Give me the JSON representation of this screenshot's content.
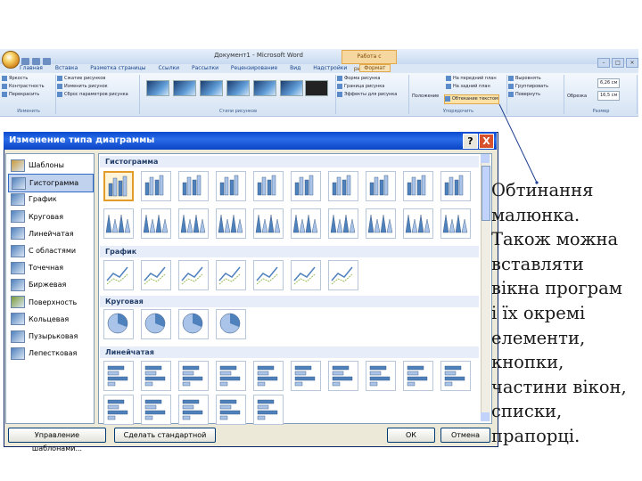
{
  "word_window": {
    "title": "Документ1 - Microsoft Word",
    "context_tab_title": "Работа с рисунками",
    "tabs": [
      "Главная",
      "Вставка",
      "Разметка страницы",
      "Ссылки",
      "Рассылки",
      "Рецензирование",
      "Вид",
      "Надстройки",
      "Формат"
    ],
    "active_tab": "Формат",
    "groups": [
      {
        "label": "Изменить",
        "rows": [
          "Яркость",
          "Контрастность",
          "Перекрасить"
        ]
      },
      {
        "label": "",
        "rows": [
          "Сжатие рисунков",
          "Изменить рисунок",
          "Сброс параметров рисунка"
        ]
      },
      {
        "label": "Стили рисунков",
        "rows": []
      },
      {
        "label": "",
        "rows": [
          "Форма рисунка",
          "Граница рисунка",
          "Эффекты для рисунка"
        ]
      },
      {
        "label": "Упорядочить",
        "rows": [
          "Положение",
          "На передний план",
          "На задний план",
          "Обтекание текстом"
        ]
      },
      {
        "label": "",
        "rows": [
          "Выровнять",
          "Группировать",
          "Повернуть"
        ]
      },
      {
        "label": "Размер",
        "rows": [
          "Обрезка",
          "6,26 см",
          "16,5 см"
        ]
      }
    ]
  },
  "dialog": {
    "title": "Изменение типа диаграммы",
    "help": "?",
    "close": "X",
    "chart_types": [
      {
        "label": "Шаблоны",
        "icon": "folder-icon"
      },
      {
        "label": "Гистограмма",
        "icon": "column-chart-icon",
        "selected": true
      },
      {
        "label": "График",
        "icon": "line-chart-icon"
      },
      {
        "label": "Круговая",
        "icon": "pie-chart-icon"
      },
      {
        "label": "Линейчатая",
        "icon": "bar-chart-icon"
      },
      {
        "label": "С областями",
        "icon": "area-chart-icon"
      },
      {
        "label": "Точечная",
        "icon": "scatter-chart-icon"
      },
      {
        "label": "Биржевая",
        "icon": "stock-chart-icon"
      },
      {
        "label": "Поверхность",
        "icon": "surface-chart-icon"
      },
      {
        "label": "Кольцевая",
        "icon": "doughnut-chart-icon"
      },
      {
        "label": "Пузырьковая",
        "icon": "bubble-chart-icon"
      },
      {
        "label": "Лепестковая",
        "icon": "radar-chart-icon"
      }
    ],
    "sections": [
      "Гистограмма",
      "График",
      "Круговая",
      "Линейчатая"
    ],
    "buttons": {
      "manage_templates": "Управление шаблонами...",
      "set_default": "Сделать стандартной",
      "ok": "ОК",
      "cancel": "Отмена"
    }
  },
  "annotation": {
    "text": "Обтинання\nмалюнка.\nТакож можна\nвставляти\nвікна програм\nі їх окремі\nелементи,\nкнопки,\nчастини вікон,\nсписки,\nпрапорці."
  },
  "colors": {
    "accent": "#4f81bd",
    "selection": "#e39b2a",
    "dialog_title": "#0a4ad0"
  }
}
